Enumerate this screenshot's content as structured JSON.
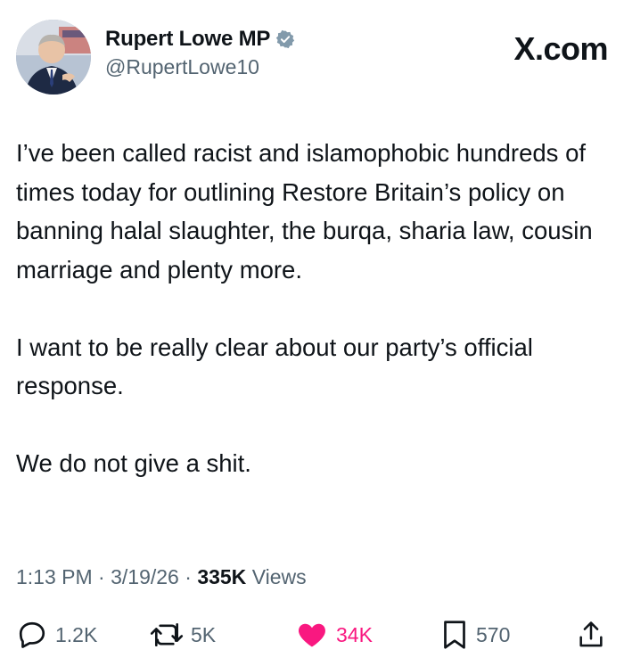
{
  "header": {
    "display_name": "Rupert Lowe MP",
    "handle": "@RupertLowe10",
    "brand": "X.com",
    "verified_icon": "verified-badge-icon",
    "colors": {
      "verified": "#829aab",
      "handle": "#536471"
    }
  },
  "tweet": {
    "paragraphs": [
      "I’ve been called racist and islamophobic hundreds of times today for outlining Restore Britain’s policy on banning halal slaughter, the burqa, sharia law, cousin marriage and plenty more.",
      "I want to be really clear about our party’s official response.",
      "We do not give a shit."
    ]
  },
  "meta": {
    "time": "1:13 PM",
    "separator": "·",
    "date": "3/19/26",
    "views_count": "335K",
    "views_label": "Views"
  },
  "actions": {
    "reply": {
      "icon": "reply-icon",
      "count": "1.2K"
    },
    "repost": {
      "icon": "repost-icon",
      "count": "5K"
    },
    "like": {
      "icon": "heart-icon",
      "count": "34K",
      "color": "#f91880"
    },
    "bookmark": {
      "icon": "bookmark-icon",
      "count": "570"
    },
    "share": {
      "icon": "share-icon"
    }
  }
}
